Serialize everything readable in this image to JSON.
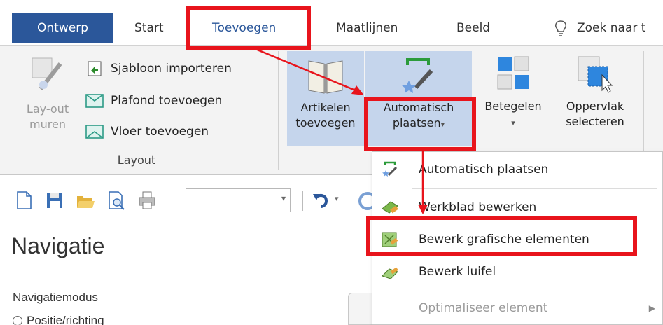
{
  "tabs": [
    {
      "label": "Ontwerp"
    },
    {
      "label": "Start"
    },
    {
      "label": "Toevoegen"
    },
    {
      "label": "Maatlijnen"
    },
    {
      "label": "Beeld"
    }
  ],
  "search": {
    "label": "Zoek naar t"
  },
  "ribbon": {
    "layout_group": {
      "label": "Layout",
      "walls_button": "Lay-out\nmuren",
      "import_template": "Sjabloon importeren",
      "add_ceiling": "Plafond toevoegen",
      "add_floor": "Vloer toevoegen"
    },
    "items_button": "Artikelen\ntoevoegen",
    "auto_place_button": "Automatisch\nplaatsen",
    "tile_button": "Betegelen",
    "select_surface_button": "Oppervlak\nselecteren"
  },
  "navigation": {
    "title": "Navigatie",
    "mode_label": "Navigatiemodus",
    "radio_position": "Positie/richting"
  },
  "menu": {
    "items": [
      {
        "label": "Automatisch plaatsen",
        "enabled": true
      },
      {
        "label": "Werkblad bewerken",
        "enabled": true
      },
      {
        "label": "Bewerk grafische elementen",
        "enabled": true
      },
      {
        "label": "Bewerk luifel",
        "enabled": true
      },
      {
        "label": "Optimaliseer element",
        "enabled": false
      }
    ]
  },
  "colors": {
    "accent": "#2b579a",
    "highlight": "#e8141c",
    "ribbon_bg": "#f3f3f3"
  }
}
